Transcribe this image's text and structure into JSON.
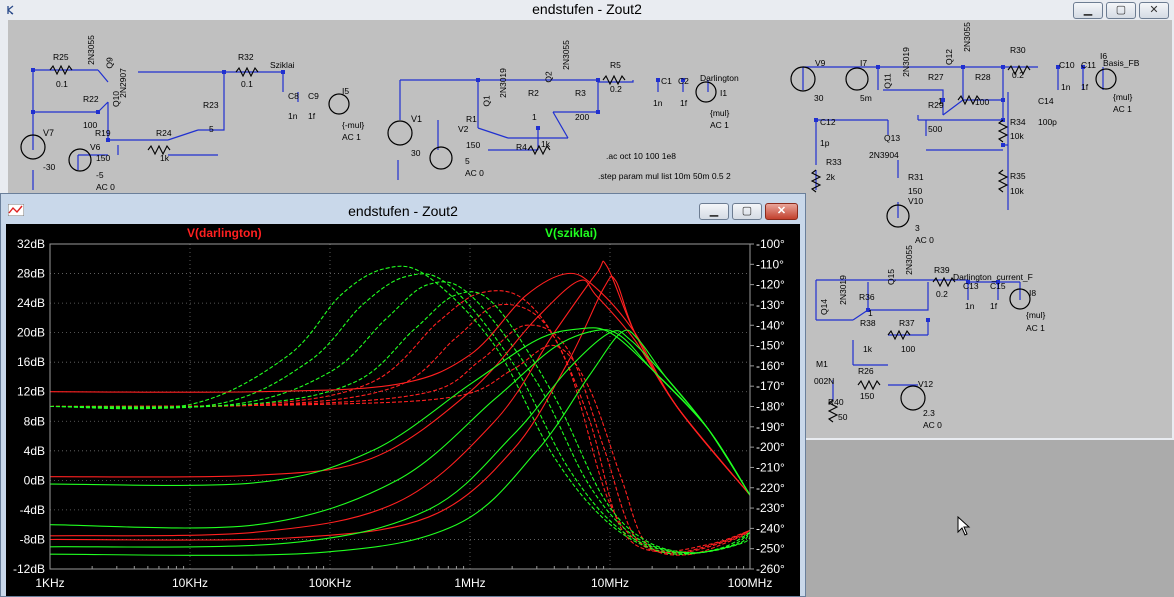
{
  "schematic": {
    "title": "endstufen - Zout2",
    "components": [
      {
        "name": "R25",
        "value": "0.1"
      },
      {
        "name": "Q9",
        "value": "2N3055"
      },
      {
        "name": "R22",
        "value": "100"
      },
      {
        "name": "Q10",
        "value": "2N2907"
      },
      {
        "name": "R19",
        "value": "150"
      },
      {
        "name": "V7",
        "value": "-30"
      },
      {
        "name": "V6",
        "value": "-5"
      },
      {
        "name": "R24",
        "value": "1k"
      },
      {
        "name": "R23",
        "value": "5"
      },
      {
        "name": "R32",
        "value": "0.1"
      },
      {
        "name": "C8",
        "value": "1n"
      },
      {
        "name": "C9",
        "value": "1f"
      },
      {
        "name": "I5",
        "value": "{-mul}"
      },
      {
        "name": "V1",
        "value": "30"
      },
      {
        "name": "Q1",
        "value": "2N3019"
      },
      {
        "name": "Q2",
        "value": "2N3055"
      },
      {
        "name": "R2",
        "value": "1"
      },
      {
        "name": "R3",
        "value": "200"
      },
      {
        "name": "R1",
        "value": "150"
      },
      {
        "name": "R4",
        "value": "1k"
      },
      {
        "name": "V2",
        "value": "5"
      },
      {
        "name": "R5",
        "value": "0.2"
      },
      {
        "name": "C1",
        "value": "1n"
      },
      {
        "name": "C2",
        "value": "1f"
      },
      {
        "name": "I1",
        "value": "{mul}"
      },
      {
        "name": "V9",
        "value": "30"
      },
      {
        "name": "I7",
        "value": "5m"
      },
      {
        "name": "Q11",
        "value": "2N3019"
      },
      {
        "name": "Q12",
        "value": "2N3055"
      },
      {
        "name": "R27",
        "value": "1"
      },
      {
        "name": "R28",
        "value": "100"
      },
      {
        "name": "R29",
        "value": "500"
      },
      {
        "name": "R30",
        "value": "0.2"
      },
      {
        "name": "C10",
        "value": "1n"
      },
      {
        "name": "C11",
        "value": "1f"
      },
      {
        "name": "I6",
        "value": "{mul}"
      },
      {
        "name": "C14",
        "value": "100p"
      },
      {
        "name": "R34",
        "value": "10k"
      },
      {
        "name": "R35",
        "value": "10k"
      },
      {
        "name": "C12",
        "value": "1p"
      },
      {
        "name": "R33",
        "value": "2k"
      },
      {
        "name": "Q13",
        "value": "2N3904"
      },
      {
        "name": "R31",
        "value": "150"
      },
      {
        "name": "V10",
        "value": "3"
      },
      {
        "name": "Q14",
        "value": "2N3019"
      },
      {
        "name": "Q15",
        "value": "2N3055"
      },
      {
        "name": "R36",
        "value": "1"
      },
      {
        "name": "R38",
        "value": "1k"
      },
      {
        "name": "R37",
        "value": "100"
      },
      {
        "name": "R39",
        "value": "0.2"
      },
      {
        "name": "C13",
        "value": "1n"
      },
      {
        "name": "C15",
        "value": "1f"
      },
      {
        "name": "I8",
        "value": "{mul}"
      },
      {
        "name": "M1",
        "value": "002N"
      },
      {
        "name": "R26",
        "value": "150"
      },
      {
        "name": "R40",
        "value": "50"
      },
      {
        "name": "V12",
        "value": "2.3"
      }
    ],
    "net_labels": [
      "Sziklai",
      "Darlington",
      "Basis_FB",
      "Darlington_current_F"
    ],
    "source_labels": {
      "ac0": "AC 0",
      "ac1": "AC 1"
    },
    "directives": [
      ".ac oct 10 100 1e8",
      ".step param mul list  10m 50m 0.5  2"
    ]
  },
  "plot_window": {
    "title": "endstufen - Zout2",
    "traces": [
      {
        "name": "V(darlington)",
        "color": "#ff2020"
      },
      {
        "name": "V(sziklai)",
        "color": "#20ff20"
      }
    ]
  },
  "chart_data": {
    "type": "line",
    "title": "",
    "x_scale": "log",
    "x_ticks": [
      "1KHz",
      "10KHz",
      "100KHz",
      "1MHz",
      "10MHz",
      "100MHz"
    ],
    "x_range_hz": [
      1000,
      100000000
    ],
    "y_left_ticks": [
      "32dB",
      "28dB",
      "24dB",
      "20dB",
      "16dB",
      "12dB",
      "8dB",
      "4dB",
      "0dB",
      "-4dB",
      "-8dB",
      "-12dB"
    ],
    "y_left_range_db": [
      -12,
      32
    ],
    "y_right_ticks": [
      "-100°",
      "-110°",
      "-120°",
      "-130°",
      "-140°",
      "-150°",
      "-160°",
      "-170°",
      "-180°",
      "-190°",
      "-200°",
      "-210°",
      "-220°",
      "-230°",
      "-240°",
      "-250°",
      "-260°"
    ],
    "y_right_range_deg": [
      -260,
      -100
    ],
    "legend": [
      "V(darlington)",
      "V(sziklai)"
    ],
    "series": [
      {
        "name": "V(darlington)",
        "quantity": "magnitude",
        "step": 1,
        "points": [
          [
            1000,
            12
          ],
          [
            30000,
            12
          ],
          [
            300000,
            13
          ],
          [
            1000000,
            17
          ],
          [
            2500000,
            25
          ],
          [
            5000000,
            28
          ],
          [
            8000000,
            26
          ],
          [
            15000000,
            20
          ],
          [
            30000000,
            10
          ],
          [
            100000000,
            -2
          ]
        ]
      },
      {
        "name": "V(darlington)",
        "quantity": "magnitude",
        "step": 2,
        "points": [
          [
            1000,
            0.5
          ],
          [
            30000,
            0.7
          ],
          [
            200000,
            3
          ],
          [
            1000000,
            12
          ],
          [
            3000000,
            22
          ],
          [
            6000000,
            27
          ],
          [
            8000000,
            25
          ],
          [
            15000000,
            19
          ],
          [
            30000000,
            10
          ],
          [
            100000000,
            -2
          ]
        ]
      },
      {
        "name": "V(darlington)",
        "quantity": "magnitude",
        "step": 3,
        "points": [
          [
            1000,
            -7.5
          ],
          [
            30000,
            -7
          ],
          [
            300000,
            -3
          ],
          [
            1500000,
            8
          ],
          [
            4000000,
            20
          ],
          [
            8000000,
            28
          ],
          [
            9500000,
            29
          ],
          [
            15000000,
            20
          ],
          [
            30000000,
            10
          ],
          [
            100000000,
            -2
          ]
        ]
      },
      {
        "name": "V(darlington)",
        "quantity": "magnitude",
        "step": 4,
        "points": [
          [
            1000,
            -8
          ],
          [
            50000,
            -7.8
          ],
          [
            500000,
            -5
          ],
          [
            2000000,
            4
          ],
          [
            5000000,
            16
          ],
          [
            9000000,
            26
          ],
          [
            11000000,
            27
          ],
          [
            15000000,
            20
          ],
          [
            30000000,
            10
          ],
          [
            100000000,
            -2
          ]
        ]
      },
      {
        "name": "V(sziklai)",
        "quantity": "magnitude",
        "step": 1,
        "points": [
          [
            1000,
            -0.5
          ],
          [
            30000,
            -0.3
          ],
          [
            200000,
            4
          ],
          [
            1000000,
            13
          ],
          [
            3000000,
            19
          ],
          [
            6000000,
            20.5
          ],
          [
            10000000,
            20
          ],
          [
            20000000,
            15
          ],
          [
            50000000,
            7
          ],
          [
            100000000,
            -2
          ]
        ]
      },
      {
        "name": "V(sziklai)",
        "quantity": "magnitude",
        "step": 2,
        "points": [
          [
            1000,
            -6
          ],
          [
            30000,
            -6
          ],
          [
            300000,
            0
          ],
          [
            1500000,
            11
          ],
          [
            4000000,
            18
          ],
          [
            8000000,
            20.3
          ],
          [
            12000000,
            19.5
          ],
          [
            20000000,
            15
          ],
          [
            50000000,
            7
          ],
          [
            100000000,
            -2
          ]
        ]
      },
      {
        "name": "V(sziklai)",
        "quantity": "magnitude",
        "step": 3,
        "points": [
          [
            1000,
            -9
          ],
          [
            50000,
            -8.5
          ],
          [
            500000,
            -4
          ],
          [
            2000000,
            6
          ],
          [
            5000000,
            15
          ],
          [
            10000000,
            20
          ],
          [
            14000000,
            19
          ],
          [
            25000000,
            14
          ],
          [
            50000000,
            7
          ],
          [
            100000000,
            -2
          ]
        ]
      },
      {
        "name": "V(sziklai)",
        "quantity": "magnitude",
        "step": 4,
        "points": [
          [
            1000,
            -10
          ],
          [
            80000,
            -9.8
          ],
          [
            800000,
            -6
          ],
          [
            3000000,
            4
          ],
          [
            7000000,
            14
          ],
          [
            12000000,
            20
          ],
          [
            16000000,
            19
          ],
          [
            25000000,
            14
          ],
          [
            50000000,
            7
          ],
          [
            100000000,
            -2
          ]
        ]
      },
      {
        "name": "V(darlington)",
        "quantity": "phase",
        "step": 1,
        "points": [
          [
            1000,
            -180
          ],
          [
            30000,
            -179
          ],
          [
            200000,
            -168
          ],
          [
            600000,
            -138
          ],
          [
            1200000,
            -124
          ],
          [
            2500000,
            -128
          ],
          [
            5000000,
            -160
          ],
          [
            10000000,
            -228
          ],
          [
            20000000,
            -250
          ],
          [
            50000000,
            -248
          ],
          [
            100000000,
            -241
          ]
        ]
      },
      {
        "name": "V(darlington)",
        "quantity": "phase",
        "step": 2,
        "points": [
          [
            1000,
            -180
          ],
          [
            40000,
            -179
          ],
          [
            300000,
            -170
          ],
          [
            800000,
            -146
          ],
          [
            1600000,
            -130
          ],
          [
            3500000,
            -140
          ],
          [
            7000000,
            -185
          ],
          [
            12000000,
            -240
          ],
          [
            25000000,
            -252
          ],
          [
            60000000,
            -247
          ],
          [
            100000000,
            -241
          ]
        ]
      },
      {
        "name": "V(darlington)",
        "quantity": "phase",
        "step": 3,
        "points": [
          [
            1000,
            -180
          ],
          [
            50000,
            -179
          ],
          [
            500000,
            -173
          ],
          [
            1200000,
            -157
          ],
          [
            2500000,
            -140
          ],
          [
            5000000,
            -152
          ],
          [
            9000000,
            -200
          ],
          [
            15000000,
            -244
          ],
          [
            30000000,
            -252
          ],
          [
            70000000,
            -246
          ],
          [
            100000000,
            -241
          ]
        ]
      },
      {
        "name": "V(darlington)",
        "quantity": "phase",
        "step": 4,
        "points": [
          [
            1000,
            -180
          ],
          [
            80000,
            -179
          ],
          [
            800000,
            -175
          ],
          [
            2000000,
            -162
          ],
          [
            4000000,
            -150
          ],
          [
            7000000,
            -170
          ],
          [
            12000000,
            -215
          ],
          [
            18000000,
            -247
          ],
          [
            35000000,
            -253
          ],
          [
            80000000,
            -245
          ],
          [
            100000000,
            -241
          ]
        ]
      },
      {
        "name": "V(sziklai)",
        "quantity": "phase",
        "step": 1,
        "points": [
          [
            1000,
            -180
          ],
          [
            10000,
            -179
          ],
          [
            50000,
            -155
          ],
          [
            120000,
            -125
          ],
          [
            250000,
            -112
          ],
          [
            500000,
            -116
          ],
          [
            1500000,
            -150
          ],
          [
            4000000,
            -205
          ],
          [
            10000000,
            -238
          ],
          [
            25000000,
            -252
          ],
          [
            60000000,
            -250
          ],
          [
            100000000,
            -242
          ]
        ]
      },
      {
        "name": "V(sziklai)",
        "quantity": "phase",
        "step": 2,
        "points": [
          [
            1000,
            -180
          ],
          [
            15000,
            -179
          ],
          [
            70000,
            -158
          ],
          [
            170000,
            -130
          ],
          [
            350000,
            -116
          ],
          [
            700000,
            -120
          ],
          [
            2000000,
            -158
          ],
          [
            5000000,
            -210
          ],
          [
            12000000,
            -241
          ],
          [
            30000000,
            -252
          ],
          [
            70000000,
            -249
          ],
          [
            100000000,
            -242
          ]
        ]
      },
      {
        "name": "V(sziklai)",
        "quantity": "phase",
        "step": 3,
        "points": [
          [
            1000,
            -180
          ],
          [
            20000,
            -179
          ],
          [
            100000,
            -163
          ],
          [
            250000,
            -137
          ],
          [
            500000,
            -120
          ],
          [
            1000000,
            -125
          ],
          [
            3000000,
            -168
          ],
          [
            7000000,
            -218
          ],
          [
            15000000,
            -244
          ],
          [
            35000000,
            -252
          ],
          [
            80000000,
            -248
          ],
          [
            100000000,
            -242
          ]
        ]
      },
      {
        "name": "V(sziklai)",
        "quantity": "phase",
        "step": 4,
        "points": [
          [
            1000,
            -180
          ],
          [
            25000,
            -179
          ],
          [
            150000,
            -168
          ],
          [
            400000,
            -142
          ],
          [
            800000,
            -125
          ],
          [
            1500000,
            -130
          ],
          [
            4000000,
            -175
          ],
          [
            9000000,
            -225
          ],
          [
            18000000,
            -246
          ],
          [
            40000000,
            -252
          ],
          [
            90000000,
            -247
          ],
          [
            100000000,
            -242
          ]
        ]
      }
    ]
  }
}
